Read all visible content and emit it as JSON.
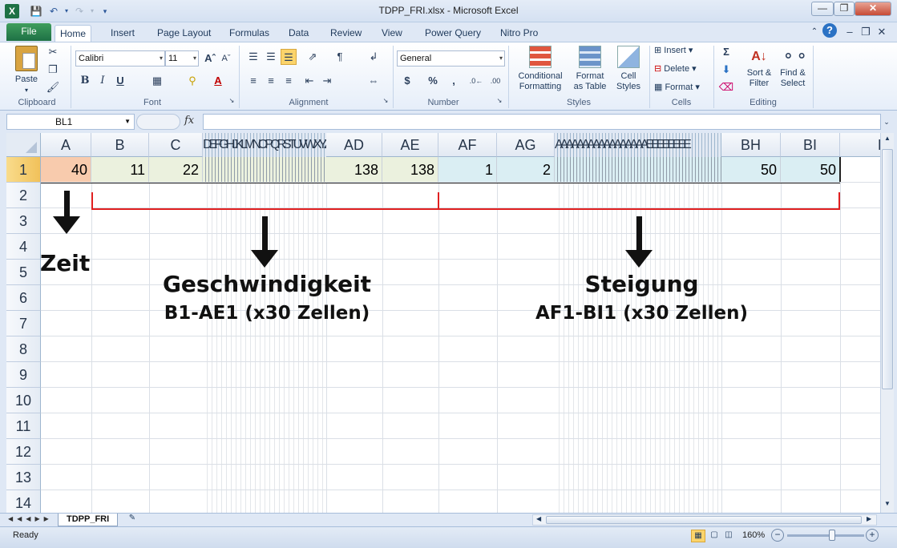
{
  "window": {
    "title": "TDPP_FRI.xlsx - Microsoft Excel",
    "minimize_icon": "minimize-icon",
    "restore_icon": "restore-icon",
    "close_icon": "close-icon"
  },
  "ribbon": {
    "tabs": [
      "File",
      "Home",
      "Insert",
      "Page Layout",
      "Formulas",
      "Data",
      "Review",
      "View",
      "Power Query",
      "Nitro Pro"
    ],
    "active_tab": "Home",
    "clipboard": {
      "label": "Clipboard",
      "paste": "Paste"
    },
    "font": {
      "label": "Font",
      "name": "Calibri",
      "size": "11"
    },
    "alignment": {
      "label": "Alignment"
    },
    "number": {
      "label": "Number",
      "format": "General"
    },
    "styles": {
      "label": "Styles",
      "conditional_1": "Conditional",
      "conditional_2": "Formatting",
      "format_table_1": "Format",
      "format_table_2": "as Table",
      "cell_styles_1": "Cell",
      "cell_styles_2": "Styles"
    },
    "cells": {
      "label": "Cells",
      "insert": "Insert",
      "delete": "Delete",
      "format": "Format"
    },
    "editing": {
      "label": "Editing",
      "sort_1": "Sort &",
      "sort_2": "Filter",
      "find_1": "Find &",
      "find_2": "Select"
    }
  },
  "formula_bar": {
    "name_box": "BL1",
    "fx": "fx",
    "value": ""
  },
  "grid": {
    "columns": [
      "A",
      "B",
      "C",
      "AD",
      "AE",
      "AF",
      "AG",
      "BH",
      "BI",
      "B"
    ],
    "hidden_cols_1": "DEFGHIJKLMNOPQRSTUVWXYZAA",
    "hidden_cols_2": "AAAAAAAAAAAAAAAAAEEEEEEEE",
    "rows": [
      "1",
      "2",
      "3",
      "4",
      "5",
      "6",
      "7",
      "8",
      "9",
      "10",
      "11",
      "12",
      "13",
      "14"
    ],
    "row1": {
      "A": "40",
      "B": "11",
      "C": "22",
      "AD": "138",
      "AE": "138",
      "AF": "1",
      "AG": "2",
      "BH": "50",
      "BI": "50"
    },
    "colors": {
      "time": "#f8cbad",
      "speed": "#ebf1de",
      "slope": "#daeef3"
    }
  },
  "annotations": {
    "zeit": "Zeit",
    "speed_title": "Geschwindigkeit",
    "speed_range": "B1-AE1 (x30 Zellen)",
    "slope_title": "Steigung",
    "slope_range": "AF1-BI1 (x30 Zellen)",
    "bracket_color": "#e02020"
  },
  "sheets": {
    "active": "TDPP_FRI"
  },
  "status": {
    "mode": "Ready",
    "zoom": "160%"
  }
}
